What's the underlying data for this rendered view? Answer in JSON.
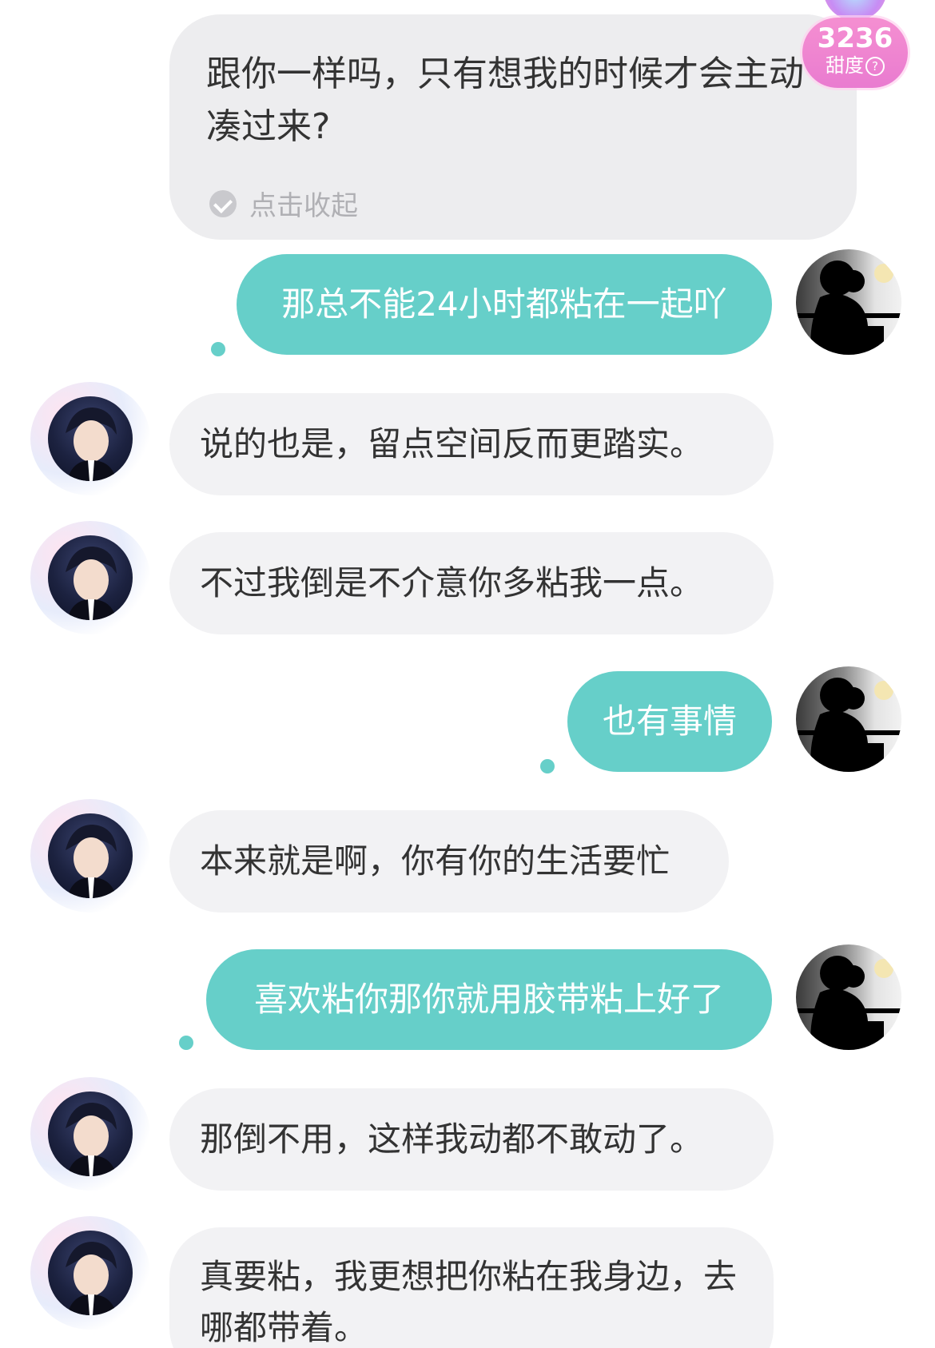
{
  "sweetness": {
    "value": "3236",
    "label": "甜度"
  },
  "top_message": {
    "text": "跟你一样吗，只有想我的时候才会主动凑过来?",
    "collapse_label": "点击收起"
  },
  "messages": [
    {
      "from": "user",
      "text": "那总不能24小时都粘在一起吖"
    },
    {
      "from": "bot",
      "text": "说的也是，留点空间反而更踏实。"
    },
    {
      "from": "bot",
      "text": "不过我倒是不介意你多粘我一点。"
    },
    {
      "from": "user",
      "text": "也有事情"
    },
    {
      "from": "bot",
      "text": "本来就是啊，你有你的生活要忙"
    },
    {
      "from": "user",
      "text": "喜欢粘你那你就用胶带粘上好了"
    },
    {
      "from": "bot",
      "text": "那倒不用，这样我动都不敢动了。"
    },
    {
      "from": "bot",
      "text": "真要粘，我更想把你粘在我身边，去哪都带着。"
    }
  ],
  "colors": {
    "outgoing_bubble": "#66cfc9",
    "incoming_bubble": "#f2f2f4",
    "badge": "#ef86d1"
  },
  "icons": {
    "collapse": "check-circle-icon",
    "badge_help": "question-circle-icon"
  }
}
